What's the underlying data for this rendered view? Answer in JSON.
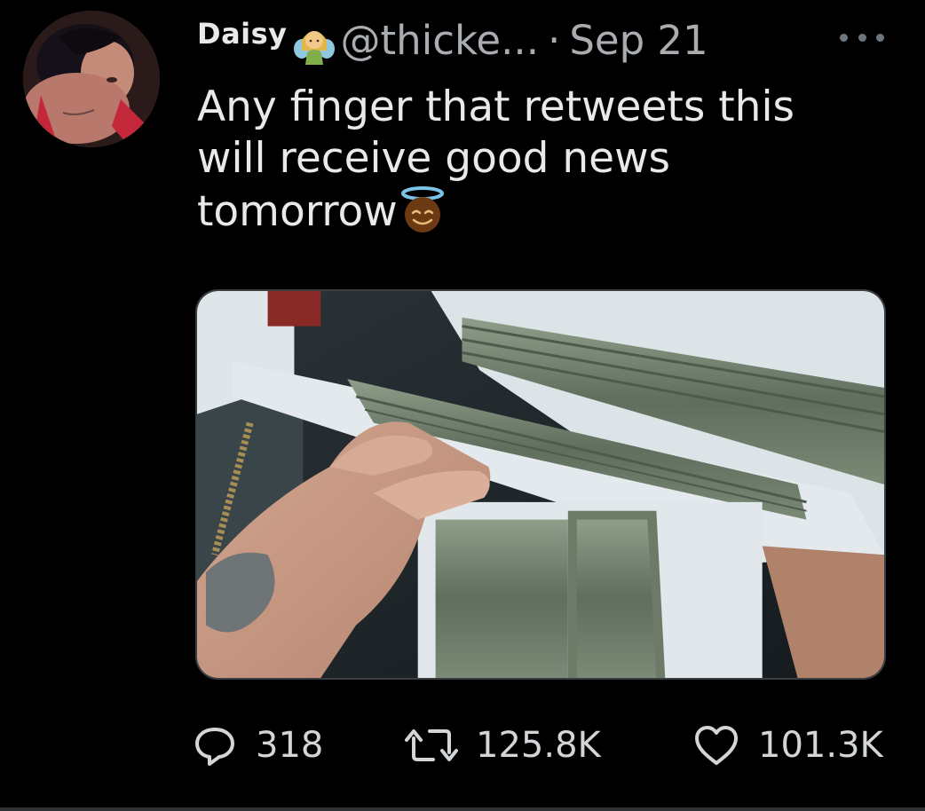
{
  "tweet": {
    "author": {
      "display_name": "Daisy",
      "name_emoji": "fairy-emoji",
      "handle": "@thicke...",
      "separator": "·",
      "date": "Sep 21"
    },
    "more_icon": "more-horizontal-icon",
    "text_lines": [
      "Any finger that retweets this",
      "will receive good news",
      "tomorrow"
    ],
    "text_emoji": "smiling-face-with-halo-emoji",
    "media": {
      "type": "photo"
    },
    "actions": {
      "reply": {
        "icon": "reply-icon",
        "count": "318"
      },
      "retweet": {
        "icon": "retweet-icon",
        "count": "125.8K"
      },
      "like": {
        "icon": "heart-icon",
        "count": "101.3K"
      }
    }
  },
  "colors": {
    "background": "#000000",
    "primary_text": "#e7e9ea",
    "secondary_text": "#a9adb1",
    "icon": "#d3d6d9",
    "border": "#3a3f44"
  }
}
